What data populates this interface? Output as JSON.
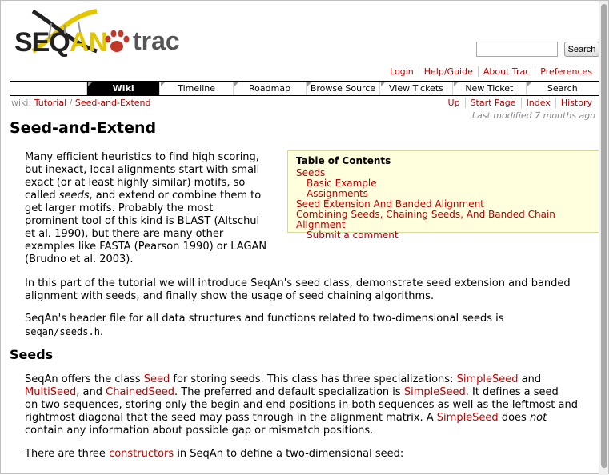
{
  "logo": {
    "seq": "SEQ",
    "an": "AN",
    "trac": "trac"
  },
  "search": {
    "placeholder": "",
    "button_label": "Search"
  },
  "metanav": [
    "Login",
    "Help/Guide",
    "About Trac",
    "Preferences"
  ],
  "mainnav": [
    "Wiki",
    "Timeline",
    "Roadmap",
    "Browse Source",
    "View Tickets",
    "New Ticket",
    "Search"
  ],
  "breadcrumb": {
    "prefix": "wiki:",
    "parent": "Tutorial",
    "sep": "/",
    "current": "Seed-and-Extend"
  },
  "ctxnav": [
    "Up",
    "Start Page",
    "Index",
    "History"
  ],
  "last_modified": "Last modified 7 months ago",
  "page_title": "Seed-and-Extend",
  "toc": {
    "title": "Table of Contents",
    "items": [
      {
        "label": "Seeds",
        "level": 1
      },
      {
        "label": "Basic Example",
        "level": 2
      },
      {
        "label": "Assignments",
        "level": 2
      },
      {
        "label": "Seed Extension And Banded Alignment",
        "level": 1
      },
      {
        "label": "Combining Seeds, Chaining Seeds, And Banded Chain Alignment",
        "level": 1
      },
      {
        "label": "Submit a comment",
        "level": 2
      }
    ]
  },
  "intro": {
    "lines": [
      "Many efficient heuristics to find high scoring,",
      "but inexact, local alignments start with small",
      "exact (or at least highly similar) motifs, so",
      [
        "called ",
        "seeds",
        ", and extend or combine them to"
      ],
      "get larger motifs. Probably the most",
      "prominent tool of this kind is BLAST (Altschul",
      "et al. 1990), but there are many other",
      "examples like FASTA (Pearson 1990) or LAGAN",
      "(Brudno et al. 2003)."
    ]
  },
  "para2": [
    "In this part of the tutorial we will introduce SeqAn's seed class, demonstrate seed extension and banded",
    "alignment with seeds, and finally show the usage of seed chaining algorithms."
  ],
  "para3": {
    "line1": "SeqAn's header file for all data structures and functions related to two-dimensional seeds is",
    "code": "seqan/seeds.h",
    "end": "."
  },
  "seeds_heading": "Seeds",
  "seeds_para": {
    "l1a": "SeqAn offers the class ",
    "l1_link": "Seed",
    "l1b": " for storing seeds. This class has three specializations: ",
    "l1_link2": "SimpleSeed",
    "l1c": " and",
    "l2_link1": "MultiSeed",
    "l2a": ", and ",
    "l2_link2": "ChainedSeed",
    "l2b": ". The preferred and default specialization is ",
    "l2_link3": "SimpleSeed",
    "l2c": ". It defines a seed",
    "l3": "on two sequences, storing only the begin and end positions in both sequences as well as the leftmost and",
    "l4a": "rightmost diagonal that the seed may pass through in the alignment matrix. A ",
    "l4_link": "SimpleSeed",
    "l4b": " does ",
    "l4_em": "not",
    "l5": "contain any information about possible gap or mismatch positions."
  },
  "constructors_para": {
    "a": "There are three ",
    "link": "constructors",
    "b": " in SeqAn to define a two-dimensional seed:"
  },
  "colors": {
    "link": "#bb0000",
    "toc_bg": "#ffffdd",
    "logo_yellow": "#e3c600",
    "paw_red": "#c0392b"
  }
}
